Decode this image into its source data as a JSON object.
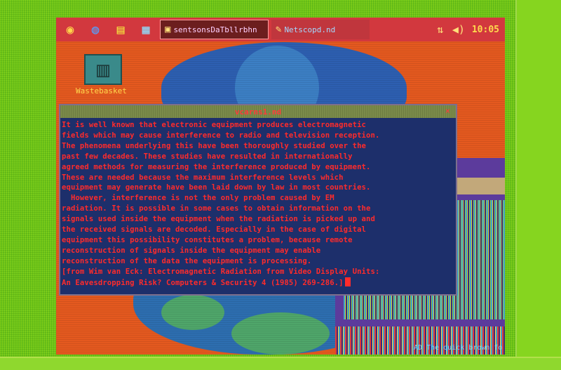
{
  "colors": {
    "surround": "#72c81c",
    "desktop": "#e4591f",
    "panel": "#d2383e",
    "editor_bg": "#1d2f6b",
    "editor_text": "#ff2b2b"
  },
  "panel": {
    "launchers": [
      "firefox-icon",
      "globe-icon",
      "file-manager-icon",
      "calendar-icon"
    ],
    "tasks": [
      {
        "label": "sentsonsDaTbllrbhn",
        "icon": "terminal-icon",
        "active": true
      },
      {
        "label": "Netscopd.nd",
        "icon": "editor-icon",
        "active": false
      }
    ],
    "tray": [
      "network-icon",
      "volume-icon"
    ],
    "clock": "10:05"
  },
  "desktop": {
    "icon_label": "Wastebasket"
  },
  "editor": {
    "title": "vcarns1.nd",
    "close_glyph": "×",
    "lines": [
      "It is well known that electronic equipment produces electromagnetic",
      "fields which may cause interference to radio and television reception.",
      "The phenomena underlying this have been thoroughly studied over the",
      "past few decades. These studies have resulted in internationally",
      "agreed methods for measuring the interference produced by equipment.",
      "These are needed because the maximum interference levels which",
      "equipment may generate have been laid down by law in most countries.",
      "  However, interference is not the only problem caused by EM",
      "radiation. It is possible in some cases to obtain information on the",
      "signals used inside the equipment when the radiation is picked up and",
      "the received signals are decoded. Especially in the case of digital",
      "equipment this possibility constitutes a problem, because remote",
      "reconstruction of signals inside the equipment may enable",
      "reconstruction of the data the equipment is processing.",
      "[from Wim van Eck: Electromagnetic Radiation from Video Display Units:",
      "An Eavesdropping Risk? Computers & Security 4 (1985) 269-286.]"
    ]
  },
  "background_window": {
    "status_text": "AD The quick brown fo"
  }
}
